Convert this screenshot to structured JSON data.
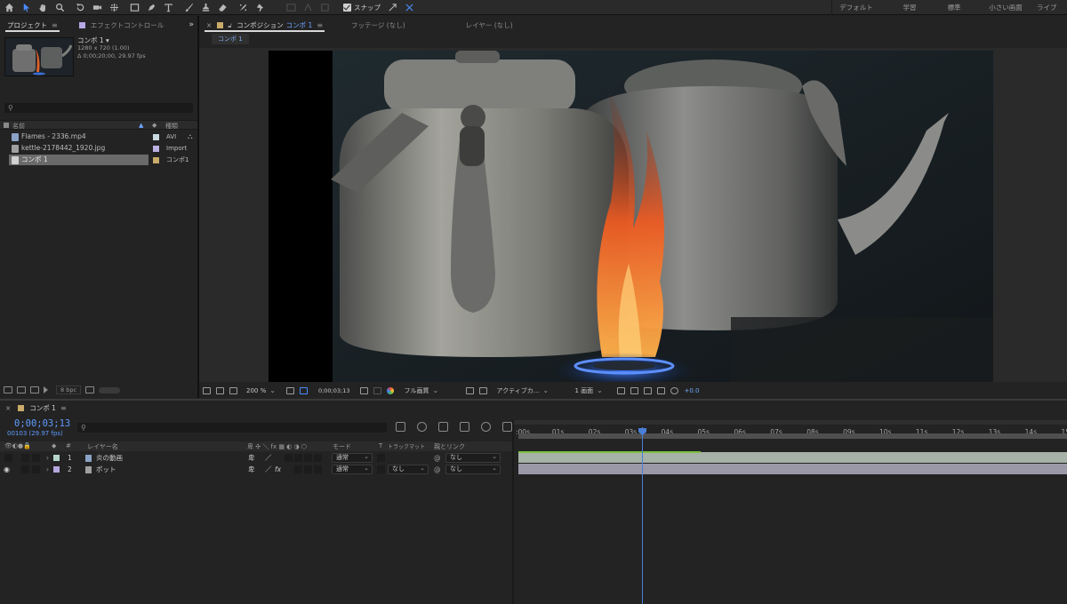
{
  "toolbar": {
    "tools": [
      "home-icon",
      "selection-icon",
      "hand-icon",
      "zoom-icon",
      "rotate-icon",
      "camera-orbit-icon",
      "pan-behind-icon",
      "rectangle-icon",
      "pen-icon",
      "type-icon",
      "brush-icon",
      "clone-stamp-icon",
      "eraser-icon",
      "roto-brush-icon",
      "puppet-icon"
    ],
    "snap_label": "スナップ",
    "workspaces": [
      "デフォルト",
      "学習",
      "標準",
      "小さい画面",
      "ライブ"
    ]
  },
  "project_panel": {
    "tab_label": "プロジェクト",
    "effects_tab_label": "エフェクトコントロール",
    "comp_name": "コンポ 1 ▾",
    "comp_size": "1280 x 720 (1.00)",
    "comp_duration": "Δ 0;00;20;00, 29.97 fps",
    "search_placeholder": "",
    "col_name": "名前",
    "col_type": "種類",
    "items": [
      {
        "name": "Flames - 2336.mp4",
        "type": "AVI",
        "label_color": "#c9d9e2"
      },
      {
        "name": "kettle-2178442_1920.jpg",
        "type": "Import",
        "label_color": "#bdb1e3"
      },
      {
        "name": "コンポ 1",
        "type": "コンポ1",
        "label_color": "#c9ab6a"
      }
    ],
    "bpc_label": "8 bpc"
  },
  "composition_panel": {
    "tab_label": "コンポジション",
    "tab_comp": "コンポ 1",
    "footage_tab": "フッテージ (なし)",
    "layer_tab": "レイヤー (なし)",
    "subtab": "コンポ 1",
    "zoom": "200 %",
    "timecode": "0;00;03;13",
    "resolution": "フル画質",
    "camera": "アクティブカ...",
    "views": "1 画面",
    "exposure": "+0.0"
  },
  "timeline": {
    "tab_label": "コンポ 1",
    "current_time": "0;00;03;13",
    "frame_fps": "00103 (29.97 fps)",
    "columns": {
      "num": "#",
      "layer_name": "レイヤー名",
      "mode": "モード",
      "t": "T",
      "trkmat": "トラックマット",
      "parent": "親とリンク"
    },
    "layers": [
      {
        "num": "1",
        "name": "炎の動画",
        "label_color": "#b6d6cb",
        "mode": "通常",
        "trkmat": "",
        "parent": "なし",
        "visible": false
      },
      {
        "num": "2",
        "name": "ポット",
        "label_color": "#b5a7de",
        "mode": "通常",
        "trkmat": "なし",
        "parent": "なし",
        "visible": true
      }
    ],
    "ruler_labels": [
      ":00s",
      "01s",
      "02s",
      "03s",
      "04s",
      "05s",
      "06s",
      "07s",
      "08s",
      "09s",
      "10s",
      "11s",
      "12s",
      "13s",
      "14s",
      "15"
    ],
    "track_colors": {
      "layer1_bar": "#a6b1a7",
      "layer1_green": "#7fbf3f",
      "layer2_bar": "#9b98a8"
    },
    "playhead_fraction": 0.224
  },
  "colors": {
    "accent_blue": "#4a8cff",
    "timecode_blue": "#5f9bff"
  }
}
